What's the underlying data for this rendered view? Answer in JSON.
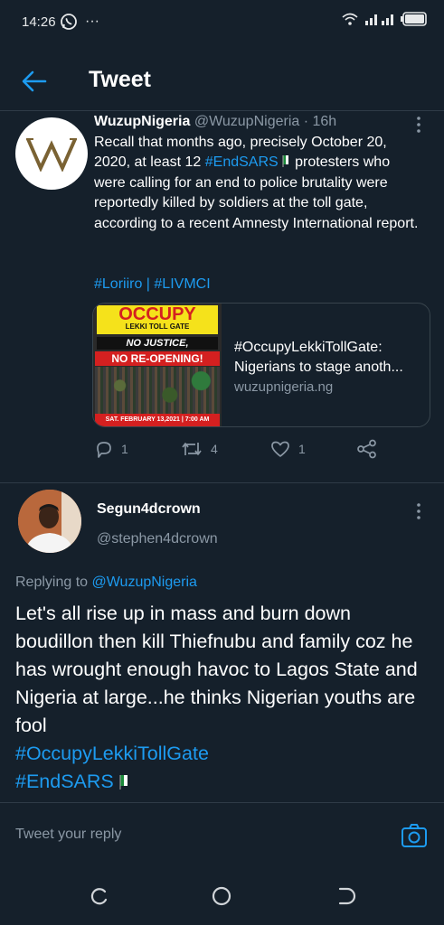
{
  "status_bar": {
    "time": "14:26",
    "dots": "···"
  },
  "header": {
    "title": "Tweet"
  },
  "tweet": {
    "author_name": "WuzupNigeria",
    "handle": "@WuzupNigeria",
    "time": "· 16h",
    "text_part1": "Recall that months ago, precisely October 20, 2020, at least 12 ",
    "text_hashtag": "#EndSARS",
    "text_part2": " protesters who were calling for an end to police brutality were reportedly killed by soldiers at the toll gate, according to a recent Amnesty International report.",
    "tags": "#Loriiro | #LIVMCI",
    "card": {
      "image_occupy": "OCCUPY",
      "image_lekki": "LEKKI TOLL GATE",
      "image_no_justice": "NO JUSTICE,",
      "image_no_reopening": "NO RE-OPENING!",
      "image_date": "SAT. FEBRUARY 13,2021 | 7:00 AM",
      "title": "#OccupyLekkiTollGate: Nigerians to stage anoth...",
      "domain": "wuzupnigeria.ng"
    },
    "replies": "1",
    "retweets": "4",
    "likes": "1"
  },
  "reply": {
    "author_name": "Segun4dcrown",
    "handle": "@stephen4dcrown",
    "replying_to_label": "Replying to ",
    "replying_to_handle": "@WuzupNigeria",
    "text": "Let's all rise up in mass and burn down boudillon then kill Thiefnubu and family coz he has wrought enough havoc to Lagos State and Nigeria at large...he thinks Nigerian youths are fool",
    "hashtag1": "#OccupyLekkiTollGate",
    "hashtag2": "#EndSARS"
  },
  "compose": {
    "placeholder": "Tweet your reply"
  },
  "colors": {
    "background": "#15202b",
    "accent": "#1d9bf0",
    "muted": "#8b98a5"
  },
  "icons": [
    "back-arrow-icon",
    "more-vert-icon",
    "reply-icon",
    "retweet-icon",
    "like-icon",
    "share-icon",
    "camera-icon",
    "nav-recent-icon",
    "nav-home-icon",
    "nav-back-icon"
  ]
}
